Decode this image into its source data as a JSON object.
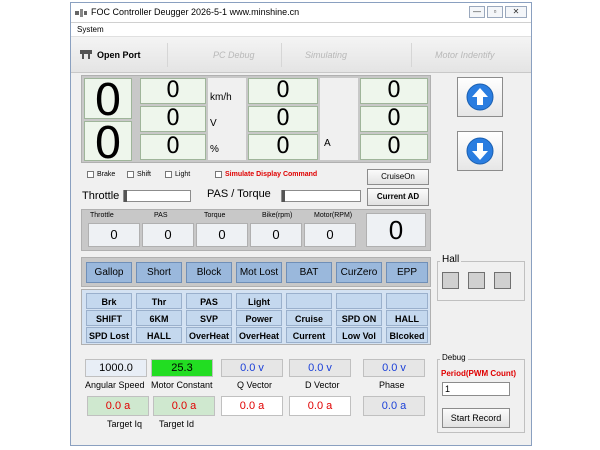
{
  "window": {
    "title": "FOC Controller Deugger  2026-5-1 www.minshine.cn",
    "minimize_glyph": "—",
    "maximize_glyph": "▫",
    "close_glyph": "✕"
  },
  "menu": {
    "system": "System"
  },
  "toolbar": {
    "open_port": "Open Port",
    "pc_debug": "PC Debug",
    "simulating": "Simulating",
    "motor_indentify": "Motor Indentify"
  },
  "display": {
    "big_top": "0",
    "big_bottom": "0",
    "mid_col1": [
      "0",
      "0",
      "0"
    ],
    "units_col1": [
      "km/h",
      "V",
      "%"
    ],
    "mid_col2": [
      "0",
      "0",
      "0"
    ],
    "unit_col2": "A",
    "right_col": [
      "0",
      "0",
      "0"
    ]
  },
  "controls": {
    "brake": "Brake",
    "shift": "Shift",
    "light": "Light",
    "simulate_display": "Simulate Display Command",
    "cruise_on": "CruiseOn",
    "current_ad": "Current AD",
    "throttle": "Throttle",
    "pas_torque": "PAS / Torque"
  },
  "readings": {
    "labels": [
      "Throttle",
      "PAS",
      "Torque",
      "Bike(rpm)",
      "Motor(RPM)"
    ],
    "values": [
      "0",
      "0",
      "0",
      "0",
      "0"
    ],
    "big_value": "0"
  },
  "flags": [
    "Gallop",
    "Short",
    "Block",
    "Mot Lost",
    "BAT",
    "CurZero",
    "EPP"
  ],
  "status_rows": [
    [
      "Brk",
      "Thr",
      "PAS",
      "Light",
      "",
      "",
      ""
    ],
    [
      "SHIFT",
      "6KM",
      "SVP",
      "Power",
      "Cruise",
      "SPD ON",
      "HALL"
    ],
    [
      "SPD Lost",
      "HALL",
      "OverHeat",
      "OverHeat",
      "Current",
      "Low Vol",
      "Blcoked"
    ]
  ],
  "hall": {
    "title": "Hall"
  },
  "foc": {
    "angular_speed": "1000.0",
    "motor_constant": "25.3",
    "q_vector": "0.0 v",
    "d_vector": "0.0 v",
    "phase": "0.0 v",
    "target_iq": "0.0 a",
    "target_id": "0.0 a",
    "cur_a": "0.0 a",
    "cur_b": "0.0 a",
    "cur_c": "0.0 a",
    "labels": {
      "angular_speed": "Angular Speed",
      "motor_constant": "Motor Constant",
      "q_vector": "Q Vector",
      "d_vector": "D Vector",
      "phase": "Phase",
      "target_iq": "Target Iq",
      "target_id": "Target Id"
    }
  },
  "debug": {
    "title": "Debug",
    "period_label": "Period(PWM Count)",
    "period_value": "1",
    "start_record": "Start Record"
  },
  "colors": {
    "accent_green": "#22dd22",
    "accent_red": "#e00000",
    "vector_blue": "#1a3fd8",
    "current_red": "#e00000",
    "arrow_blue": "#2a7de0"
  }
}
